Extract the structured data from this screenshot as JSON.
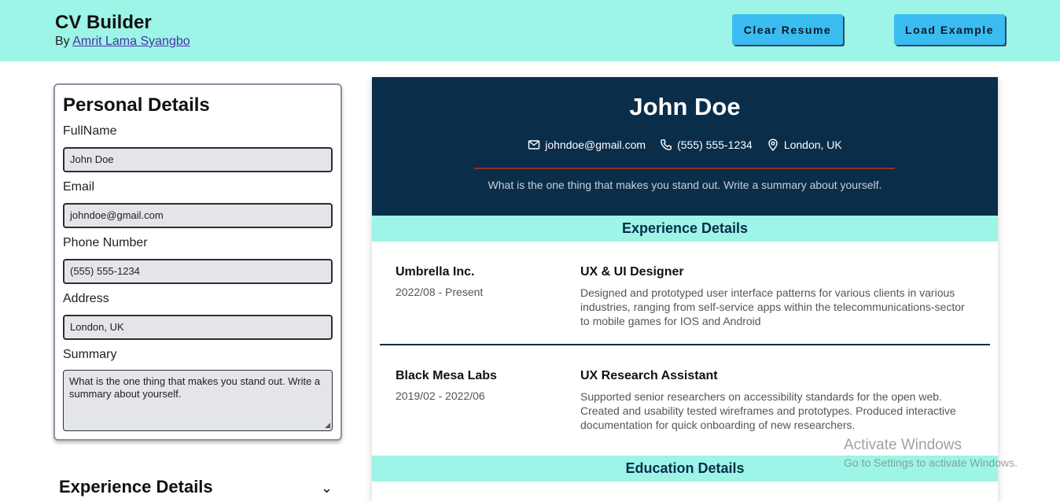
{
  "header": {
    "title": "CV Builder",
    "by_prefix": "By",
    "author": "Amrit Lama Syangbo",
    "clear_label": "Clear Resume",
    "load_label": "Load Example"
  },
  "form": {
    "heading": "Personal Details",
    "fullname_label": "FullName",
    "fullname_value": "John Doe",
    "email_label": "Email",
    "email_value": "johndoe@gmail.com",
    "phone_label": "Phone Number",
    "phone_value": "(555) 555-1234",
    "address_label": "Address",
    "address_value": "London, UK",
    "summary_label": "Summary",
    "summary_value": "What is the one thing that makes you stand out. Write a summary about yourself.",
    "experience_heading": "Experience Details",
    "experience_toggle": "⌄"
  },
  "resume": {
    "name": "John Doe",
    "email": "johndoe@gmail.com",
    "phone": "(555) 555-1234",
    "location": "London, UK",
    "summary": "What is the one thing that makes you stand out. Write a summary about yourself.",
    "experience_heading": "Experience Details",
    "education_heading": "Education Details",
    "jobs": [
      {
        "company": "Umbrella Inc.",
        "dates": "2022/08 - Present",
        "role": "UX & UI Designer",
        "description": "Designed and prototyped user interface patterns for various clients in various industries, ranging from self-service apps within the telecommunications-sector to mobile games for IOS and Android"
      },
      {
        "company": "Black Mesa Labs",
        "dates": "2019/02 - 2022/06",
        "role": "UX Research Assistant",
        "description": "Supported senior researchers on accessibility standards for the open web. Created and usability tested wireframes and prototypes. Produced interactive documentation for quick onboarding of new researchers."
      }
    ]
  },
  "watermark": {
    "line1": "Activate Windows",
    "line2": "Go to Settings to activate Windows."
  },
  "colors": {
    "header_bg": "#9cf5e6",
    "resume_header_bg": "#0a2d4a",
    "button_bg": "#3bbcf0",
    "accent_rule": "#9a2a2a"
  }
}
